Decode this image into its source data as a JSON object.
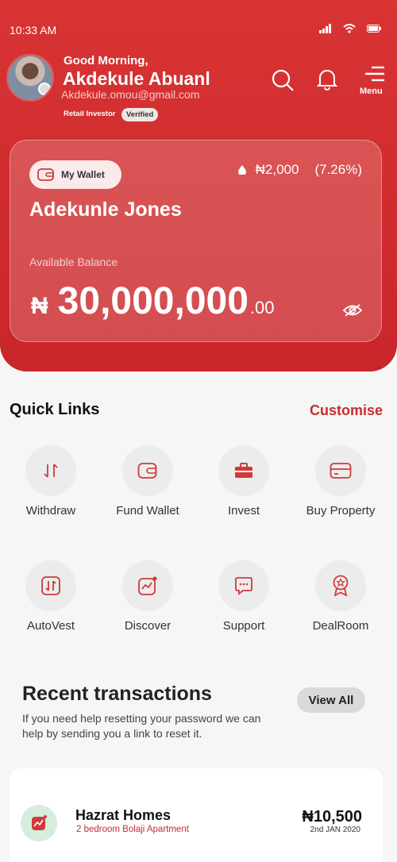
{
  "status_bar": {
    "time": "10:33 AM"
  },
  "user": {
    "greeting": "Good Morning,",
    "name": "Akdekule Abuanl",
    "email": "Akdekule.omou@gmail.com",
    "role": "Retail Investor",
    "verified_label": "Verified"
  },
  "header": {
    "menu_label": "Menu"
  },
  "wallet": {
    "pill_label": "My Wallet",
    "change_amount": "₦2,000",
    "change_percent": "(7.26%)",
    "holder_name": "Adekunle Jones",
    "available_label": "Available Balance",
    "currency": "₦",
    "balance": "30,000,000",
    "balance_decimal": ".00"
  },
  "quick_links": {
    "title": "Quick Links",
    "customise_label": "Customise",
    "items": [
      {
        "label": "Withdraw",
        "icon": "transfer-arrows-icon"
      },
      {
        "label": "Fund Wallet",
        "icon": "wallet-icon"
      },
      {
        "label": "Invest",
        "icon": "briefcase-icon"
      },
      {
        "label": "Buy Property",
        "icon": "card-icon"
      },
      {
        "label": "AutoVest",
        "icon": "autovest-icon"
      },
      {
        "label": "Discover",
        "icon": "discover-chart-icon"
      },
      {
        "label": "Support",
        "icon": "chat-support-icon"
      },
      {
        "label": "DealRoom",
        "icon": "award-badge-icon"
      }
    ]
  },
  "recent_transactions": {
    "title": "Recent transactions",
    "subtitle": "If you need help resetting your password we can help by sending you a link to reset it.",
    "view_all_label": "View All",
    "items": [
      {
        "name": "Hazrat Homes",
        "description": "2 bedroom Bolaji Apartment",
        "amount": "₦10,500",
        "date": "2nd JAN 2020"
      }
    ]
  },
  "colors": {
    "brand_red": "#c8262a",
    "accent_red": "#c62d2d",
    "icon_red": "#d03a3a"
  }
}
